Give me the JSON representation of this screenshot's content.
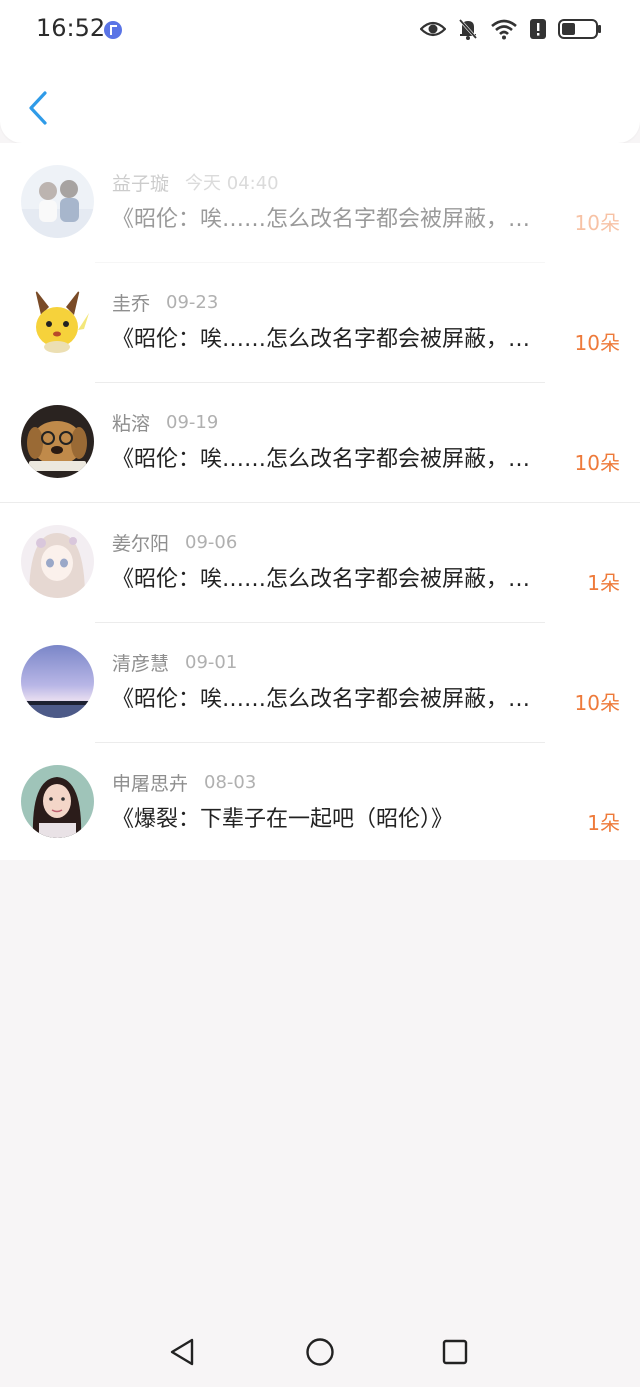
{
  "status_bar": {
    "time": "16:52"
  },
  "messages": [
    {
      "name": "益子璇",
      "date": "今天 04:40",
      "text": "《昭伦：唉……怎么改名字都会被屏蔽，…",
      "count": "10朵"
    },
    {
      "name": "圭乔",
      "date": "09-23",
      "text": "《昭伦：唉……怎么改名字都会被屏蔽，…",
      "count": "10朵"
    },
    {
      "name": "粘溶",
      "date": "09-19",
      "text": "《昭伦：唉……怎么改名字都会被屏蔽，…",
      "count": "10朵"
    },
    {
      "name": "姜尔阳",
      "date": "09-06",
      "text": "《昭伦：唉……怎么改名字都会被屏蔽，…",
      "count": "1朵"
    },
    {
      "name": "清彦慧",
      "date": "09-01",
      "text": "《昭伦：唉……怎么改名字都会被屏蔽，…",
      "count": "10朵"
    },
    {
      "name": "申屠思卉",
      "date": "08-03",
      "text": "《爆裂：下辈子在一起吧（昭伦）》",
      "count": "1朵"
    }
  ],
  "colors": {
    "accent": "#2f9be8",
    "count": "#ee7a3a",
    "background": "#f7f5f6"
  },
  "icons": {
    "status": [
      "music-app-icon",
      "eye-icon",
      "bell-muted-icon",
      "wifi-icon",
      "alert-icon",
      "battery-icon"
    ],
    "nav": [
      "back-triangle-icon",
      "home-circle-icon",
      "recents-square-icon"
    ]
  }
}
